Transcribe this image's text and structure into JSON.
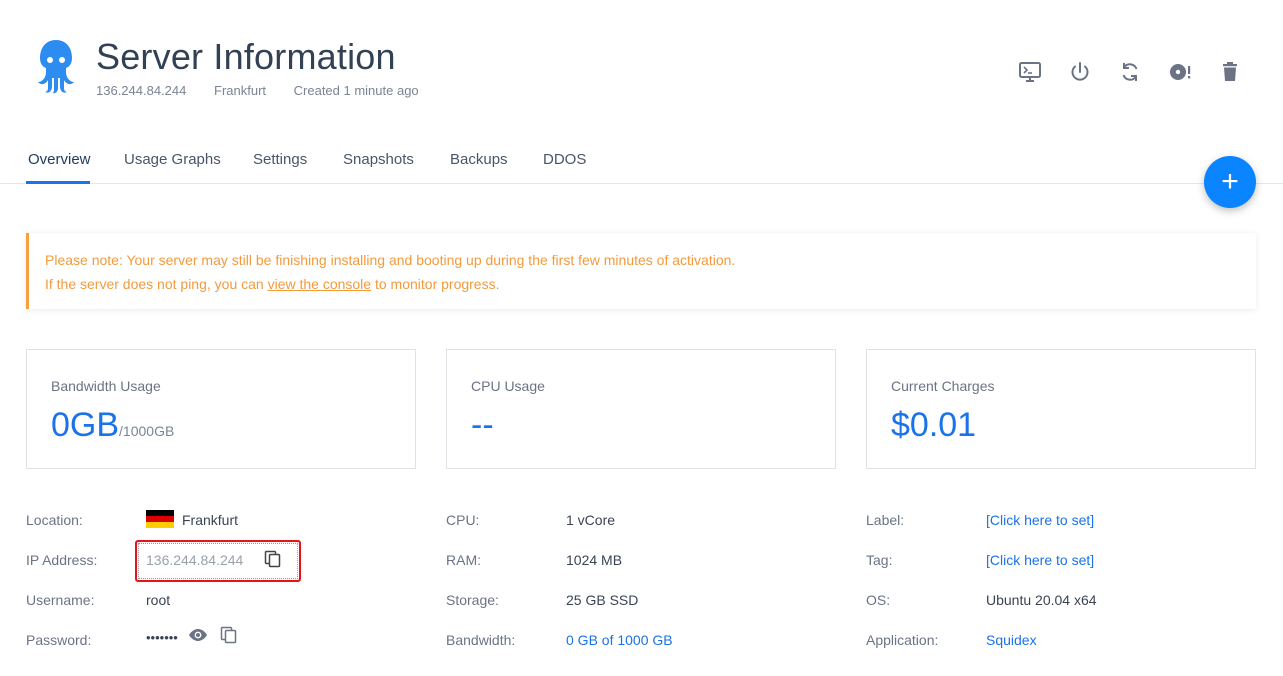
{
  "header": {
    "title": "Server Information",
    "ip": "136.244.84.244",
    "location": "Frankfurt",
    "created": "Created 1 minute ago"
  },
  "actions": [
    {
      "name": "console-icon"
    },
    {
      "name": "power-icon"
    },
    {
      "name": "restart-icon"
    },
    {
      "name": "reinstall-icon"
    },
    {
      "name": "trash-icon"
    }
  ],
  "tabs": {
    "overview": "Overview",
    "usage_graphs": "Usage Graphs",
    "settings": "Settings",
    "snapshots": "Snapshots",
    "backups": "Backups",
    "ddos": "DDOS"
  },
  "fab": {
    "label": "+"
  },
  "notice": {
    "line1": "Please note: Your server may still be finishing installing and booting up during the first few minutes of activation.",
    "line2_prefix": "If the server does not ping, you can ",
    "line2_link": "view the console",
    "line2_suffix": " to monitor progress."
  },
  "stats": {
    "bandwidth": {
      "label": "Bandwidth Usage",
      "value": "0GB",
      "unit": "/1000GB"
    },
    "cpu": {
      "label": "CPU Usage",
      "value": "--"
    },
    "charges": {
      "label": "Current Charges",
      "value": "$0.01"
    }
  },
  "details": {
    "location_label": "Location:",
    "location_value": "Frankfurt",
    "ip_label": "IP Address:",
    "ip_value": "136.244.84.244",
    "username_label": "Username:",
    "username_value": "root",
    "password_label": "Password:",
    "password_value": "•••••••",
    "cpu_label": "CPU:",
    "cpu_value": "1 vCore",
    "ram_label": "RAM:",
    "ram_value": "1024 MB",
    "storage_label": "Storage:",
    "storage_value": "25 GB SSD",
    "bandwidth_label": "Bandwidth:",
    "bandwidth_value": "0 GB of 1000 GB",
    "label_label": "Label:",
    "label_value": "[Click here to set]",
    "tag_label": "Tag:",
    "tag_value": "[Click here to set]",
    "os_label": "OS:",
    "os_value": "Ubuntu 20.04 x64",
    "application_label": "Application:",
    "application_value": "Squidex"
  },
  "colors": {
    "accent": "#1a73e8",
    "fab": "#0a84ff",
    "warning": "#f39a3d",
    "highlight": "#e11111"
  }
}
